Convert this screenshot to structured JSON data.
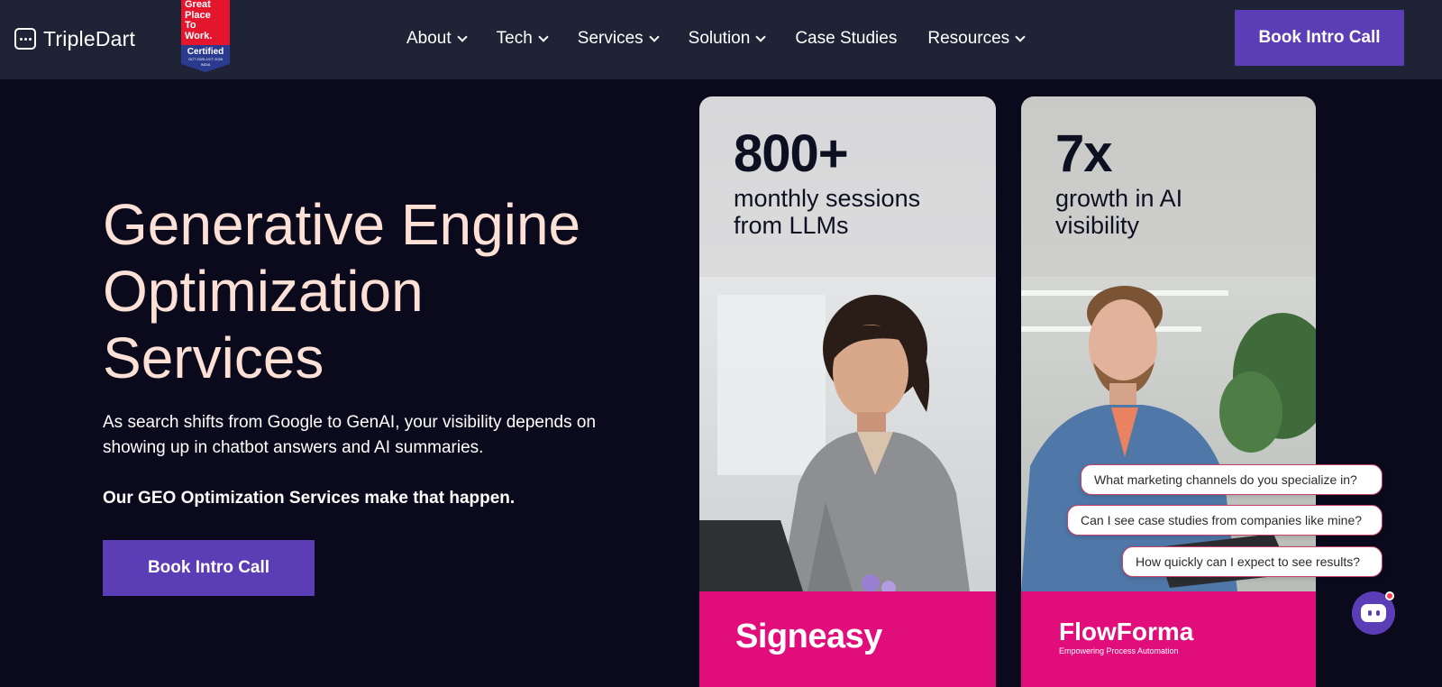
{
  "nav": {
    "logo_text": "TripleDart",
    "badge": {
      "line1": "Great",
      "line2": "Place",
      "line3": "To",
      "line4": "Work.",
      "certified": "Certified",
      "dates": "OCT 2025-OCT 2026",
      "country": "INDIA"
    },
    "menu": [
      {
        "label": "About",
        "dropdown": true
      },
      {
        "label": "Tech",
        "dropdown": true
      },
      {
        "label": "Services",
        "dropdown": true
      },
      {
        "label": "Solution",
        "dropdown": true
      },
      {
        "label": "Case Studies",
        "dropdown": false
      },
      {
        "label": "Resources",
        "dropdown": true
      }
    ],
    "cta_label": "Book Intro Call"
  },
  "hero": {
    "title_line1": "Generative Engine",
    "title_line2": "Optimization",
    "title_line3": "Services",
    "subtitle": "As search shifts from Google to GenAI, your visibility depends on showing up in chatbot answers and AI summaries.",
    "emphasis": "Our GEO Optimization Services make that happen.",
    "cta_label": "Book Intro Call"
  },
  "cards": [
    {
      "stat": "800+",
      "desc_line1": "monthly sessions",
      "desc_line2": "from LLMs",
      "brand": "Signeasy",
      "tagline": ""
    },
    {
      "stat": "7x",
      "desc_line1": "growth in AI",
      "desc_line2": "visibility",
      "brand": "FlowForma",
      "tagline": "Empowering Process Automation"
    }
  ],
  "chat": {
    "suggestions": [
      "What marketing channels do you specialize in?",
      "Can I see case studies from companies like mine?",
      "How quickly can I expect to see results?"
    ]
  },
  "colors": {
    "page_bg": "#0b0a1c",
    "nav_bg": "#1e2436",
    "accent_purple": "#5b3db5",
    "hero_title": "#fde0d6",
    "brand_pink": "#e10d7b"
  }
}
